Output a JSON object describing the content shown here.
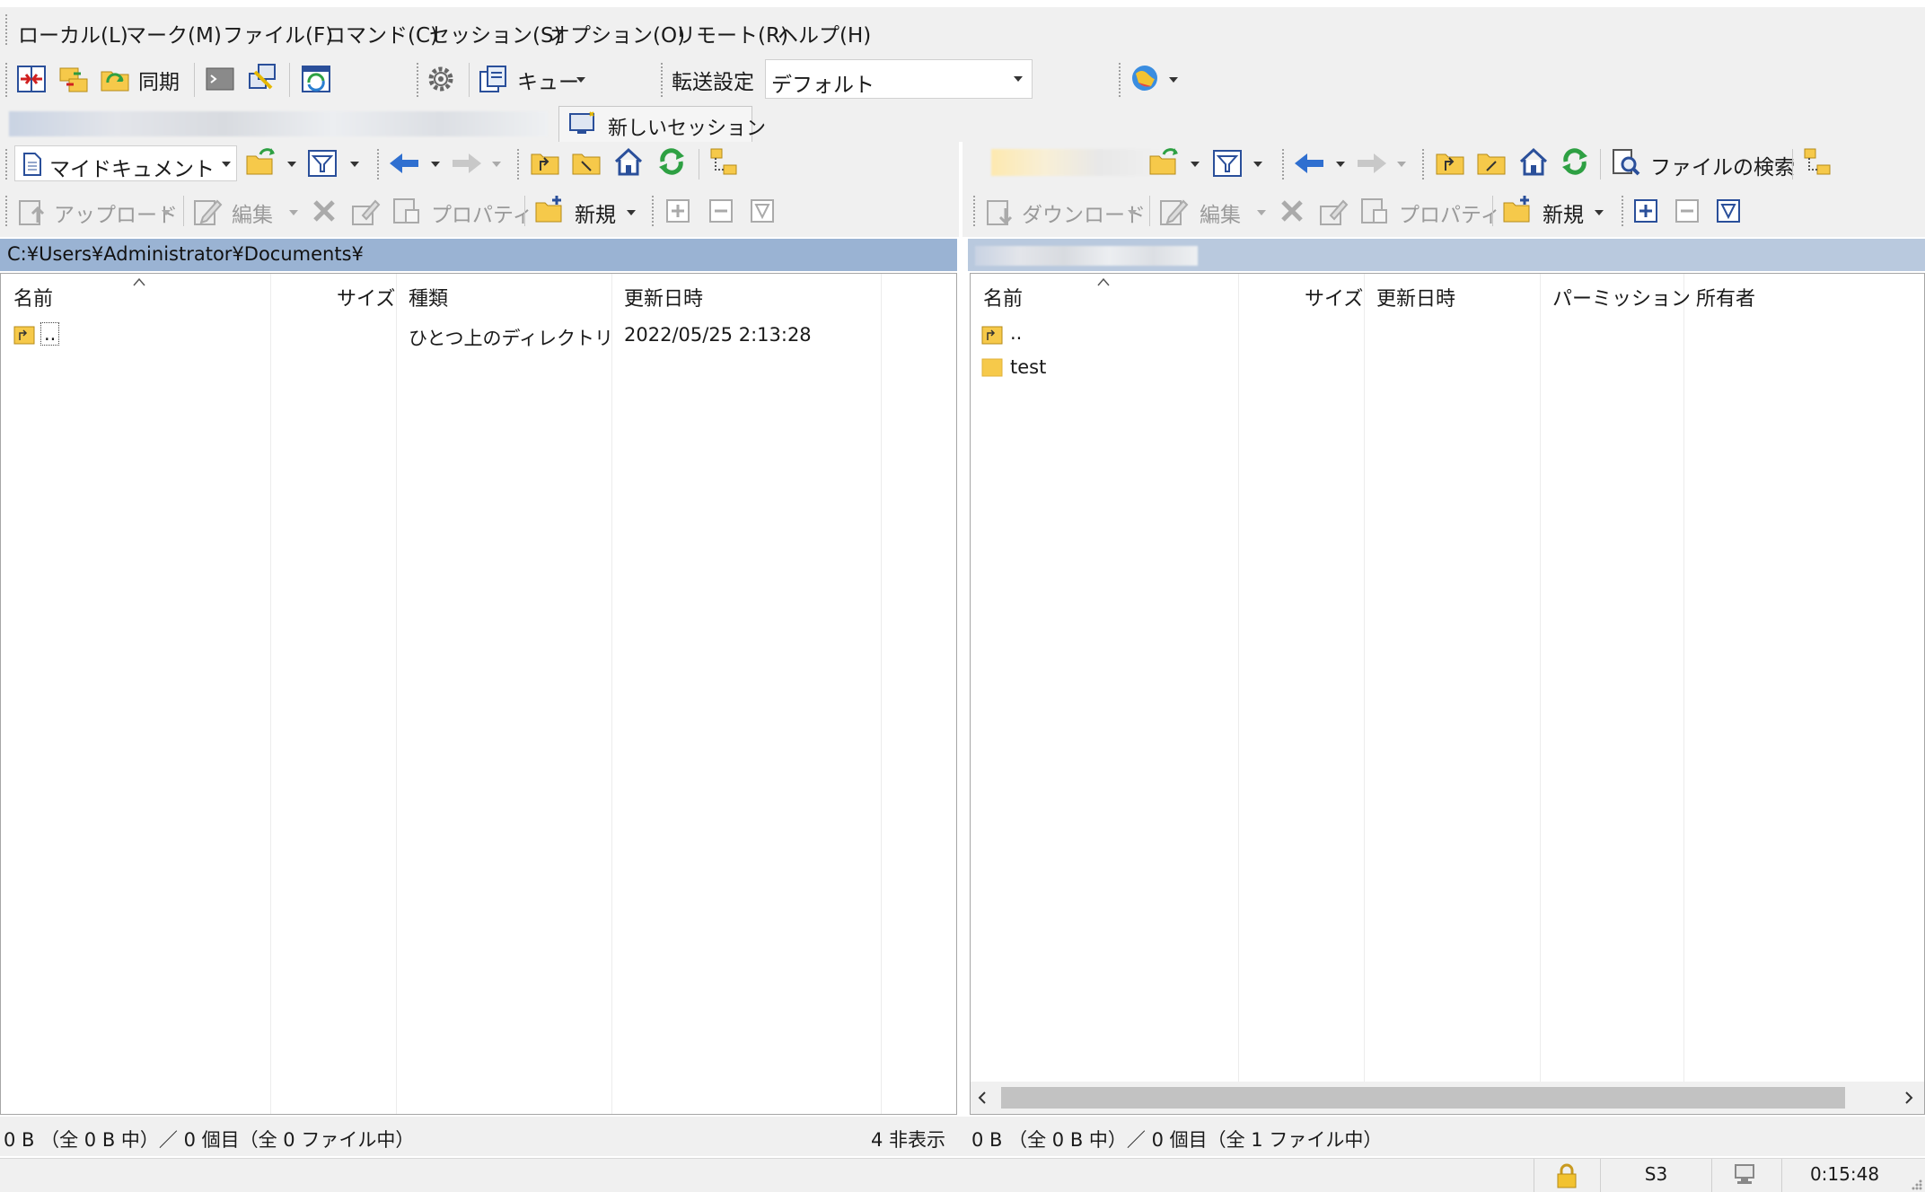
{
  "menu": [
    "ローカル(L)",
    "マーク(M)",
    "ファイル(F)",
    "コマンド(C)",
    "セッション(S)",
    "オプション(O)",
    "リモート(R)",
    "ヘルプ(H)"
  ],
  "main_toolbar": {
    "sync_label": "同期",
    "queue_label": "キュー",
    "transfer_settings_label": "転送設定",
    "transfer_settings_value": "デフォルト"
  },
  "session_tab": {
    "new_session_label": "新しいセッション"
  },
  "left_panel": {
    "location_value": "マイドキュメント",
    "toolbar": {
      "upload": "アップロード",
      "edit": "編集",
      "properties": "プロパティ",
      "new": "新規"
    },
    "path": "C:¥Users¥Administrator¥Documents¥",
    "columns": [
      "名前",
      "サイズ",
      "種類",
      "更新日時"
    ],
    "rows": [
      {
        "name": "..",
        "size": "",
        "type": "ひとつ上のディレクトリ",
        "modified": "2022/05/25  2:13:28"
      }
    ],
    "status": "0 B （全 0 B 中）／ 0 個目（全 0 ファイル中）",
    "hidden_count": "4 非表示"
  },
  "right_panel": {
    "toolbar": {
      "find_files": "ファイルの検索",
      "download": "ダウンロード",
      "edit": "編集",
      "properties": "プロパティ",
      "new": "新規"
    },
    "columns": [
      "名前",
      "サイズ",
      "更新日時",
      "パーミッション",
      "所有者"
    ],
    "rows": [
      {
        "name": "..",
        "icon": "parent-dir-icon"
      },
      {
        "name": "test",
        "icon": "folder-icon"
      }
    ],
    "status": "0 B （全 0 B 中）／ 0 個目（全 1 ファイル中）"
  },
  "bottom_status": {
    "protocol": "S3",
    "elapsed": "0:15:48"
  },
  "colors": {
    "folder": "#f6c94a",
    "accent_blue": "#2f6fd0",
    "refresh_green": "#2ea043",
    "path_left": "#9ab3d3",
    "path_right": "#b9c9de"
  }
}
